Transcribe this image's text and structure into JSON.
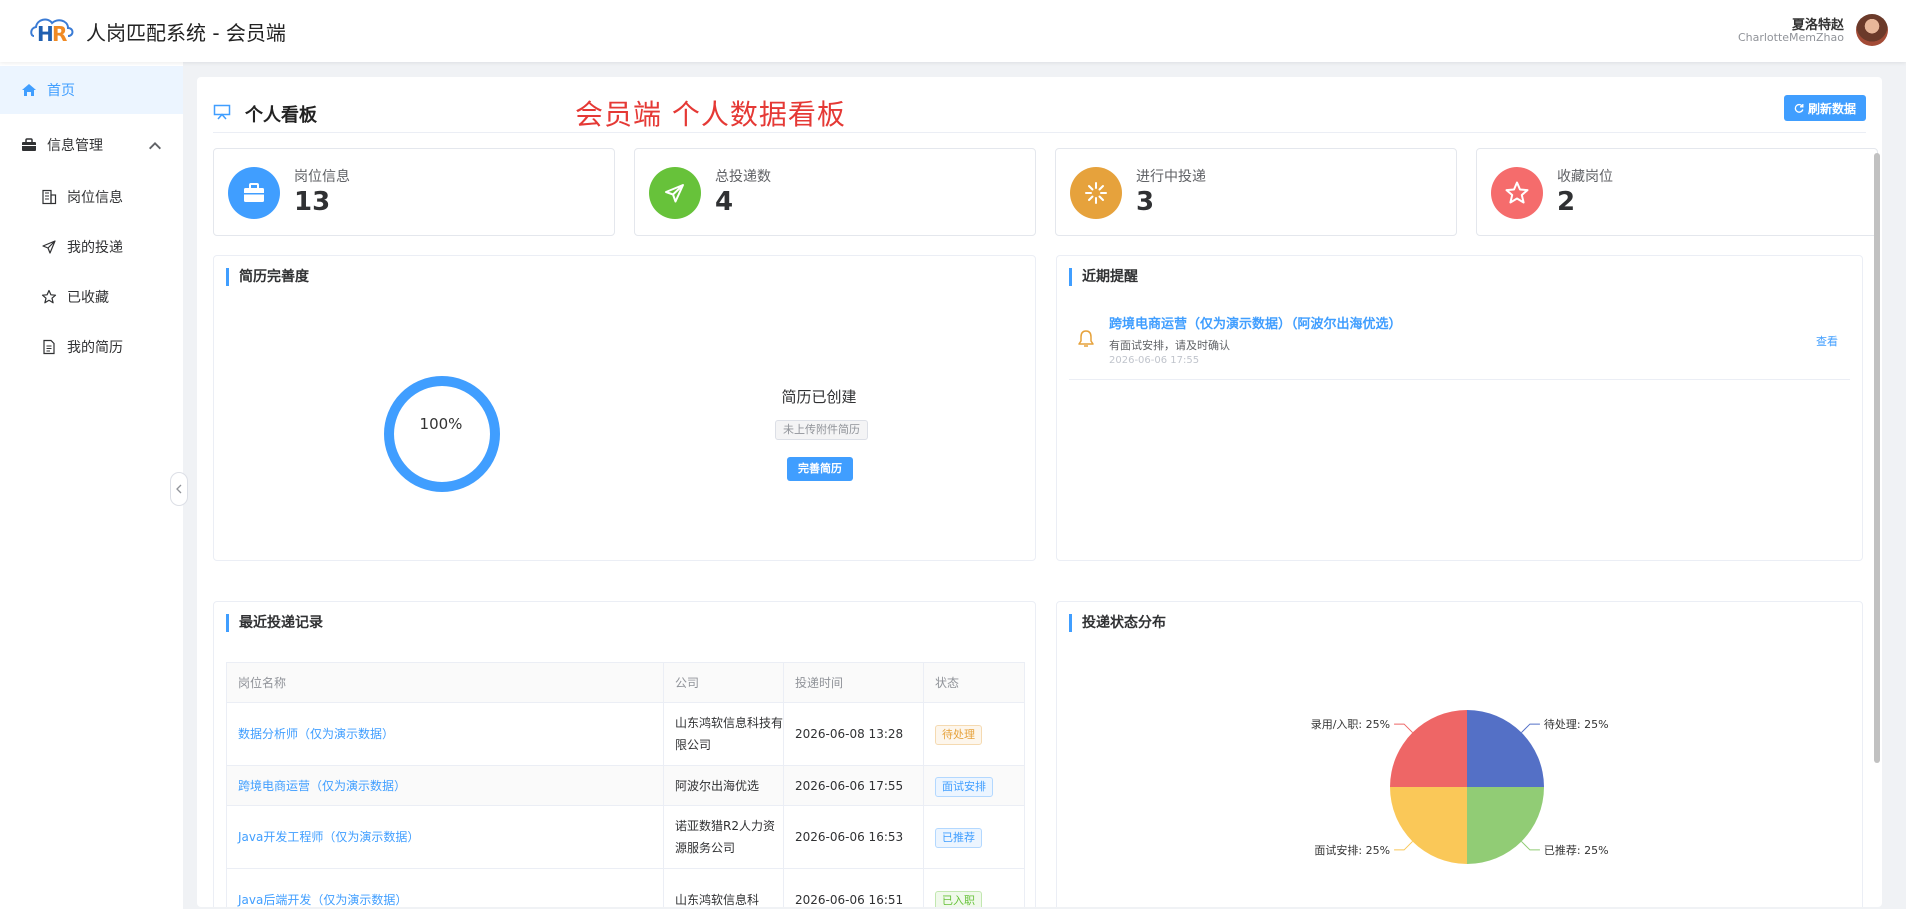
{
  "app": {
    "title": "人岗匹配系统 - 会员端",
    "logo": "HR"
  },
  "user": {
    "name": "夏洛特赵",
    "username": "CharlotteMemZhao"
  },
  "sidebar": {
    "home": "首页",
    "group": "信息管理",
    "items": [
      {
        "label": "岗位信息",
        "icon": "building-icon"
      },
      {
        "label": "我的投递",
        "icon": "send-icon"
      },
      {
        "label": "已收藏",
        "icon": "star-icon"
      },
      {
        "label": "我的简历",
        "icon": "document-icon"
      }
    ]
  },
  "page": {
    "title": "个人看板",
    "annotation": "会员端   个人数据看板",
    "refresh_label": "刷新数据"
  },
  "stats": [
    {
      "label": "岗位信息",
      "value": "13",
      "color": "#409eff",
      "icon": "briefcase-icon"
    },
    {
      "label": "总投递数",
      "value": "4",
      "color": "#67c23a",
      "icon": "send-icon"
    },
    {
      "label": "进行中投递",
      "value": "3",
      "color": "#e6a23c",
      "icon": "loading-icon"
    },
    {
      "label": "收藏岗位",
      "value": "2",
      "color": "#f56c6c",
      "icon": "star-icon"
    }
  ],
  "resume": {
    "title": "简历完善度",
    "percent": 100,
    "percent_text": "100%",
    "status": "简历已创建",
    "attachment_tag": "未上传附件简历",
    "complete_button": "完善简历"
  },
  "reminders": {
    "title": "近期提醒",
    "items": [
      {
        "title": "跨境电商运营（仅为演示数据）（阿波尔出海优选）",
        "desc": "有面试安排，请及时确认",
        "time": "2026-06-06 17:55",
        "action": "查看"
      }
    ]
  },
  "applications": {
    "title": "最近投递记录",
    "columns": [
      "岗位名称",
      "公司",
      "投递时间",
      "状态"
    ],
    "rows": [
      {
        "job": "数据分析师（仅为演示数据）",
        "company": "山东鸿软信息科技有限公司",
        "time": "2026-06-08 13:28",
        "status": "待处理"
      },
      {
        "job": "跨境电商运营（仅为演示数据）",
        "company": "阿波尔出海优选",
        "time": "2026-06-06 17:55",
        "status": "面试安排"
      },
      {
        "job": "Java开发工程师（仅为演示数据）",
        "company": "诺亚数猎R2人力资源服务公司",
        "time": "2026-06-06 16:53",
        "status": "已推荐"
      },
      {
        "job": "Java后端开发（仅为演示数据）",
        "company": "山东鸿软信息科",
        "time": "2026-06-06 16:51",
        "status": "已入职"
      }
    ]
  },
  "chart_data": {
    "type": "pie",
    "title": "投递状态分布",
    "slices": [
      {
        "name": "待处理",
        "value": 25,
        "label": "待处理: 25%",
        "color": "#5470c6"
      },
      {
        "name": "已推荐",
        "value": 25,
        "label": "已推荐: 25%",
        "color": "#91cc75"
      },
      {
        "name": "面试安排",
        "value": 25,
        "label": "面试安排: 25%",
        "color": "#fac858"
      },
      {
        "name": "录用/入职",
        "value": 25,
        "label": "录用/入职: 25%",
        "color": "#ee6666"
      }
    ]
  }
}
